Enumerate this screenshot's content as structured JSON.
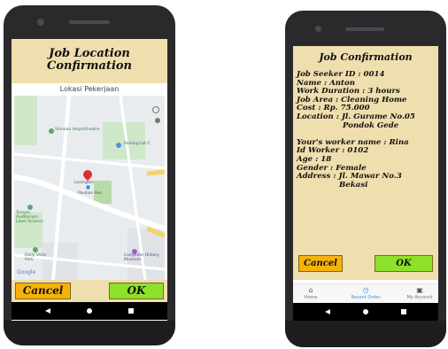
{
  "left_screen": {
    "title_line1": "Job Location",
    "title_line2": "Confirmation",
    "map_label": "Lokasi Pekerjaan",
    "map_places": {
      "place1": "Shinobu Amphitheatre",
      "place2": "Parking Lot C",
      "place3": "Lexington",
      "place4": "Pavilion Ave",
      "place5": "Temple Auditorium Lawn Science",
      "place6": "Daily Vista Park",
      "place7": "Computer History Museum",
      "google": "Google"
    },
    "cancel_label": "Cancel",
    "ok_label": "OK"
  },
  "right_screen": {
    "title": "Job Confirmation",
    "seeker_id": "Job Seeker ID : 0014",
    "name": "Name : Anton",
    "duration": "Work Duration : 3 hours",
    "area": "Job Area : Cleaning Home",
    "cost": "Cost : Rp. 75.000",
    "location_line1": "Location : Jl. Gurame No.05",
    "location_line2": "Pondok Gede",
    "worker_name": "Your's worker name : Rina",
    "worker_id": "Id Worker : 0102",
    "age": "Age : 18",
    "gender": "Gender : Female",
    "address_line1": "Address : Jl. Mawar No.3",
    "address_line2": "Bekasi",
    "cancel_label": "Cancel",
    "ok_label": "OK"
  },
  "tabs": [
    {
      "label": "Home",
      "icon": "home-icon"
    },
    {
      "label": "Recent Order",
      "icon": "recent-order-icon"
    },
    {
      "label": "My Account",
      "icon": "account-icon"
    }
  ],
  "colors": {
    "title_bar": "#efdfae",
    "cancel": "#f7b20a",
    "ok": "#8fe02a",
    "active_tab": "#4a90d9",
    "map_pin": "#d9302c"
  }
}
